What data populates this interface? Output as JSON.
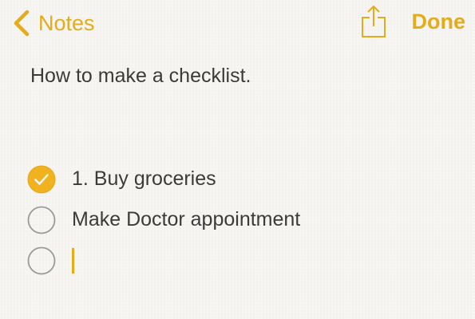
{
  "nav": {
    "back_label": "Notes",
    "done_label": "Done"
  },
  "note": {
    "title": "How to make a checklist.",
    "checklist": [
      {
        "text": "1. Buy groceries",
        "checked": true
      },
      {
        "text": "Make Doctor appointment",
        "checked": false
      },
      {
        "text": "",
        "checked": false,
        "editing": true
      }
    ]
  },
  "icons": {
    "back": "chevron-left-icon",
    "share": "share-icon",
    "checked": "checkmark-circle-filled-icon",
    "unchecked": "empty-circle-icon"
  },
  "colors": {
    "accent": "#e4ac1b",
    "text": "#3b3b3b",
    "circle_outline": "#9a9a9a",
    "paper": "#f6f5f1"
  }
}
